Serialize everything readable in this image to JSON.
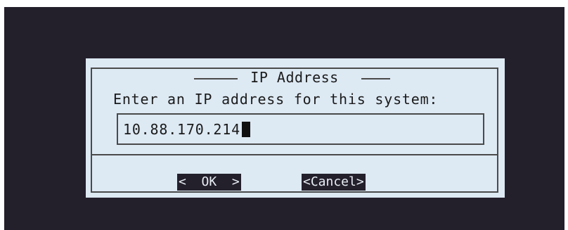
{
  "dialog": {
    "title": "IP Address",
    "prompt": "Enter an IP address for this system:",
    "input_value": "10.88.170.214",
    "ok_label": "<  OK  >",
    "cancel_label": "<Cancel>"
  },
  "colors": {
    "screen_background": "#231f2b",
    "dialog_background": "#dde9f3",
    "border": "#4a4a4a"
  }
}
